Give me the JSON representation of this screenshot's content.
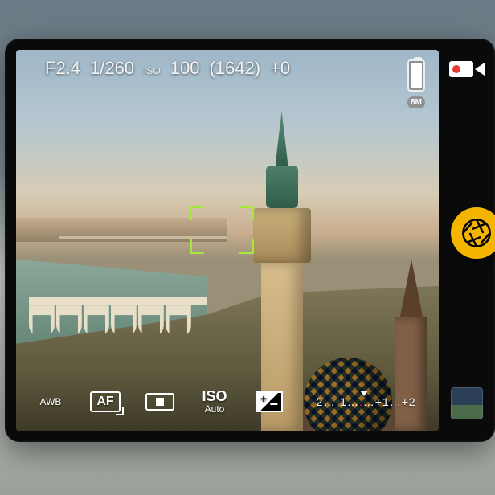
{
  "top": {
    "aperture": "F2.4",
    "shutter": "1/260",
    "iso_label": "ISO",
    "iso_value": "100",
    "shots_remaining": "(1642)",
    "ev_offset": "+0",
    "resolution_badge": "8M"
  },
  "focus": {
    "mode_label": "AF"
  },
  "bottom": {
    "wb": "AWB",
    "af": "AF",
    "iso_title": "ISO",
    "iso_mode": "Auto",
    "ev_scale": "-2…-1……+1…+2",
    "ev_scale_parts": {
      "left": "-2…-1…",
      "center": ".",
      "right": "…+1…+2"
    }
  },
  "colors": {
    "focus_box": "#a4e838",
    "shutter": "#f4b400",
    "record_dot": "#e63b30"
  }
}
